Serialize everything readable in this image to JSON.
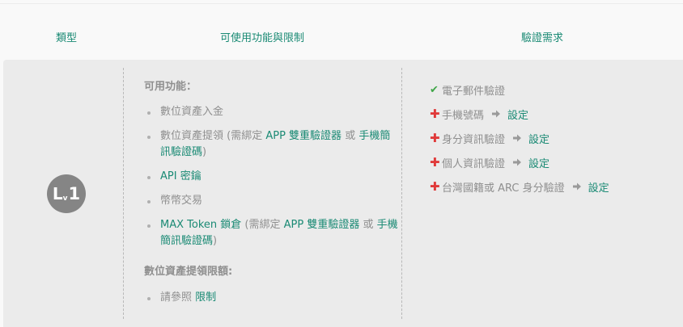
{
  "header": {
    "col_type": "類型",
    "col_features": "可使用功能與限制",
    "col_requirements": "驗證需求"
  },
  "level": {
    "letter": "L",
    "sub": "v",
    "number": "1"
  },
  "features": {
    "title": "可用功能：",
    "items": [
      {
        "parts": [
          {
            "text": "數位資產入金",
            "hl": false
          }
        ]
      },
      {
        "parts": [
          {
            "text": "數位資產提領 (需綁定 ",
            "hl": false
          },
          {
            "text": "APP 雙重驗證器",
            "hl": true
          },
          {
            "text": " 或 ",
            "hl": false
          },
          {
            "text": "手機簡訊驗證碼",
            "hl": true
          },
          {
            "text": ")",
            "hl": false
          }
        ]
      },
      {
        "parts": [
          {
            "text": "API 密鑰",
            "hl": true
          }
        ]
      },
      {
        "parts": [
          {
            "text": "幣幣交易",
            "hl": false
          }
        ]
      },
      {
        "parts": [
          {
            "text": "MAX Token 鎖倉",
            "hl": true
          },
          {
            "text": " (需綁定 ",
            "hl": false
          },
          {
            "text": "APP 雙重驗證器",
            "hl": true
          },
          {
            "text": " 或 ",
            "hl": false
          },
          {
            "text": "手機簡訊驗證碼",
            "hl": true
          },
          {
            "text": ")",
            "hl": false
          }
        ]
      }
    ],
    "limit_title": "數位資產提領限額:",
    "limit_items": [
      {
        "parts": [
          {
            "text": "請參照 ",
            "hl": false
          },
          {
            "text": "限制",
            "hl": true
          }
        ]
      }
    ]
  },
  "requirements": [
    {
      "status": "done",
      "icon": "check-icon",
      "label": "電子郵件驗證"
    },
    {
      "status": "todo",
      "icon": "plus-icon",
      "label": "手機號碼",
      "action": "設定"
    },
    {
      "status": "todo",
      "icon": "plus-icon",
      "label": "身分資訊驗證",
      "action": "設定"
    },
    {
      "status": "todo",
      "icon": "plus-icon",
      "label": "個人資訊驗證",
      "action": "設定"
    },
    {
      "status": "todo",
      "icon": "plus-icon",
      "label": "台灣國籍或 ARC 身分驗證",
      "action": "設定"
    }
  ],
  "colors": {
    "accent": "#1a8a74",
    "check": "#3fa648",
    "plus": "#e03a3a",
    "badge": "#858585",
    "row_bg": "#ebebeb"
  }
}
